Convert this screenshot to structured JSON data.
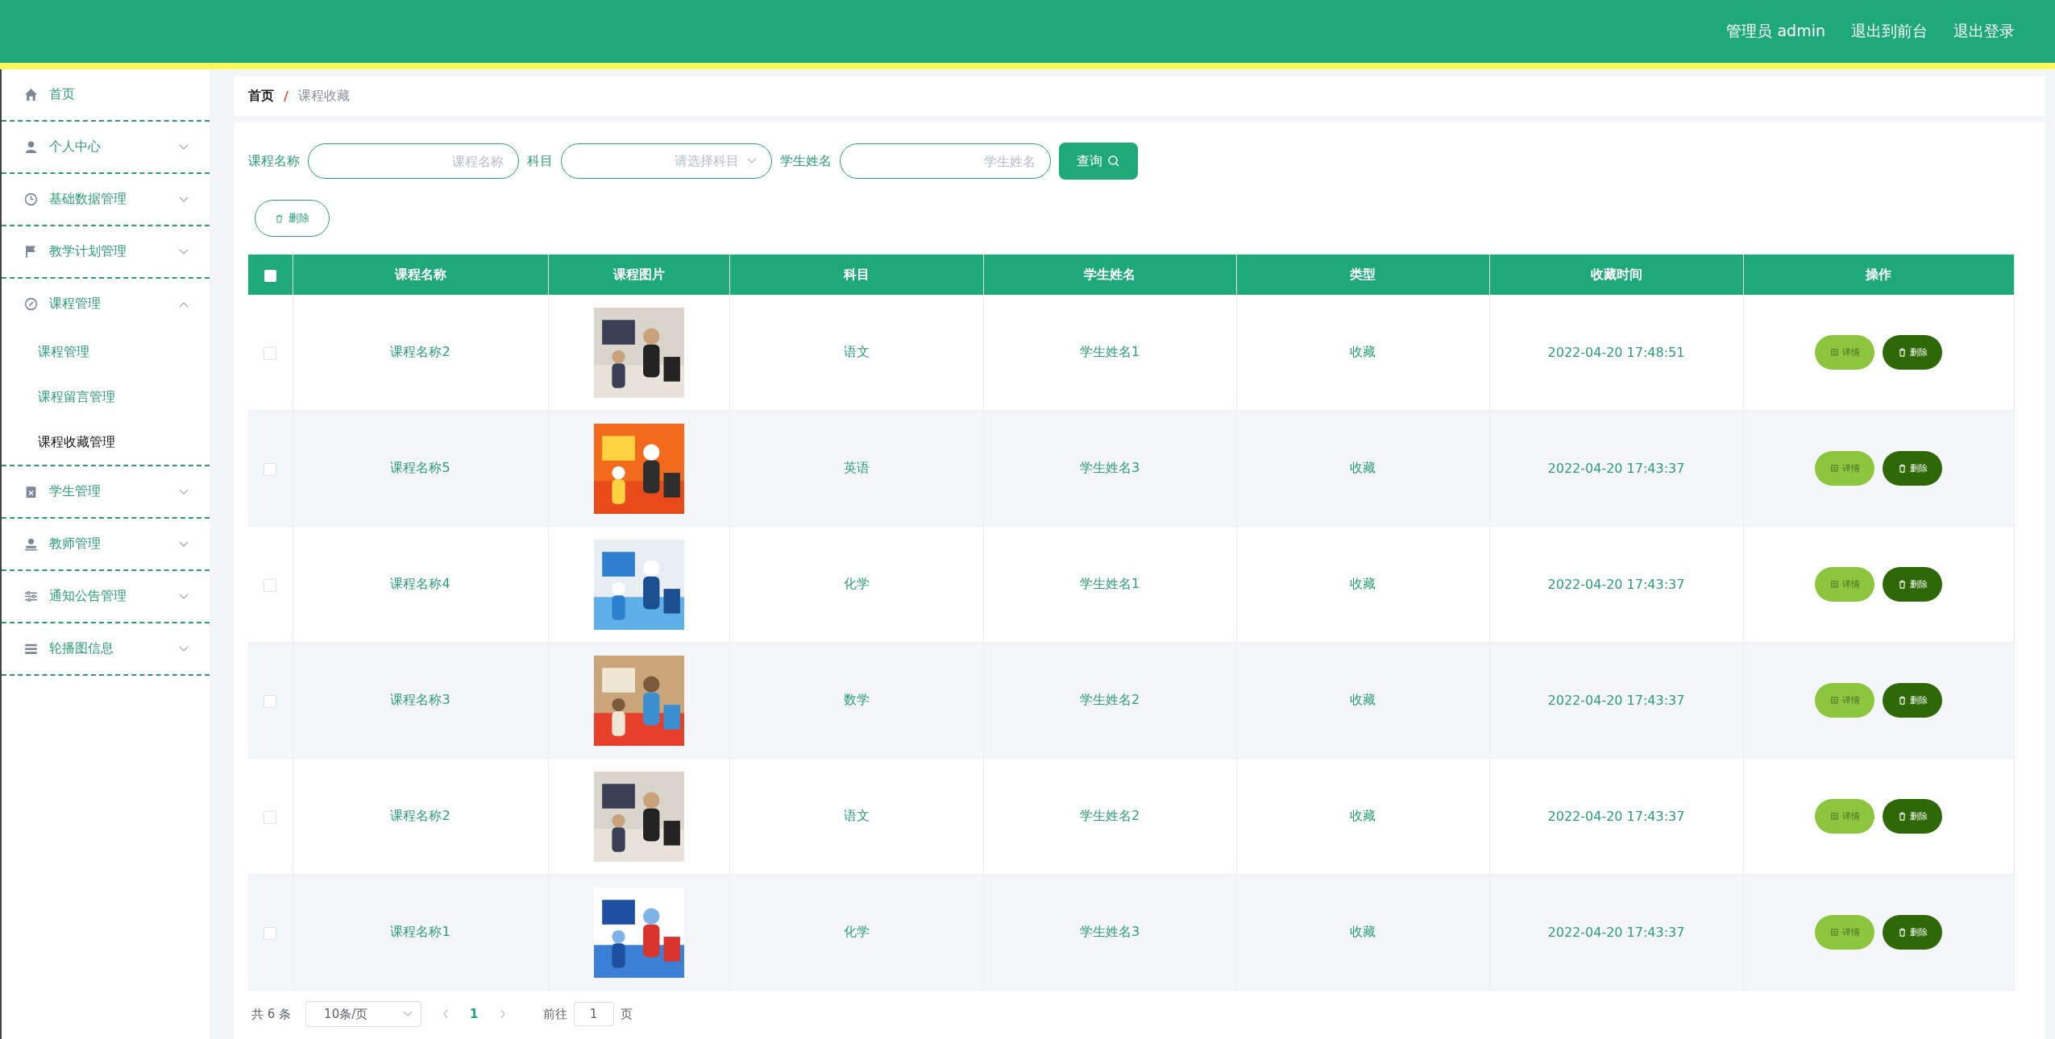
{
  "header": {
    "user": "管理员 admin",
    "links": [
      "退出到前台",
      "退出登录"
    ]
  },
  "sidebar": {
    "items": [
      {
        "label": "首页",
        "kind": "link"
      },
      {
        "label": "个人中心",
        "kind": "menu",
        "expanded": false
      },
      {
        "label": "基础数据管理",
        "kind": "menu",
        "expanded": false
      },
      {
        "label": "教学计划管理",
        "kind": "menu",
        "expanded": false
      },
      {
        "label": "课程管理",
        "kind": "menu",
        "expanded": true,
        "children": [
          {
            "label": "课程管理",
            "selected": false
          },
          {
            "label": "课程留言管理",
            "selected": false
          },
          {
            "label": "课程收藏管理",
            "selected": true
          }
        ]
      },
      {
        "label": "学生管理",
        "kind": "menu",
        "expanded": false
      },
      {
        "label": "教师管理",
        "kind": "menu",
        "expanded": false
      },
      {
        "label": "通知公告管理",
        "kind": "menu",
        "expanded": false
      },
      {
        "label": "轮播图信息",
        "kind": "menu",
        "expanded": false
      }
    ]
  },
  "breadcrumb": [
    "首页",
    "课程收藏"
  ],
  "breadcrumb_separator": "/",
  "search": {
    "fields": [
      {
        "label": "课程名称",
        "placeholder": "课程名称",
        "kind": "input"
      },
      {
        "label": "科目",
        "placeholder": "请选择科目",
        "kind": "select"
      },
      {
        "label": "学生姓名",
        "placeholder": "学生姓名",
        "kind": "input"
      }
    ],
    "button": "查询"
  },
  "delete_button": "删除",
  "table": {
    "all_checked": false,
    "columns": [
      "课程名称",
      "课程图片",
      "科目",
      "学生姓名",
      "类型",
      "收藏时间",
      "操作"
    ],
    "rows": [
      {
        "checked": false,
        "course": "课程名称2",
        "subject": "语文",
        "student": "学生姓名1",
        "type": "收藏",
        "time": "2022-04-20 17:48:51",
        "actions": [
          "详情",
          "删除"
        ]
      },
      {
        "checked": false,
        "course": "课程名称5",
        "subject": "英语",
        "student": "学生姓名3",
        "type": "收藏",
        "time": "2022-04-20 17:43:37",
        "actions": [
          "详情",
          "删除"
        ]
      },
      {
        "checked": false,
        "course": "课程名称4",
        "subject": "化学",
        "student": "学生姓名1",
        "type": "收藏",
        "time": "2022-04-20 17:43:37",
        "actions": [
          "详情",
          "删除"
        ]
      },
      {
        "checked": false,
        "course": "课程名称3",
        "subject": "数学",
        "student": "学生姓名2",
        "type": "收藏",
        "time": "2022-04-20 17:43:37",
        "actions": [
          "详情",
          "删除"
        ]
      },
      {
        "checked": false,
        "course": "课程名称2",
        "subject": "语文",
        "student": "学生姓名2",
        "type": "收藏",
        "time": "2022-04-20 17:43:37",
        "actions": [
          "详情",
          "删除"
        ]
      },
      {
        "checked": false,
        "course": "课程名称1",
        "subject": "化学",
        "student": "学生姓名3",
        "type": "收藏",
        "time": "2022-04-20 17:43:37",
        "actions": [
          "详情",
          "删除"
        ]
      }
    ]
  },
  "pagination": {
    "total": "共 6 条",
    "page_size": "10条/页",
    "pages": [
      {
        "label": "1",
        "selected": true
      }
    ],
    "goto_label": "前往",
    "goto_value": "1",
    "page_suffix": "页"
  }
}
